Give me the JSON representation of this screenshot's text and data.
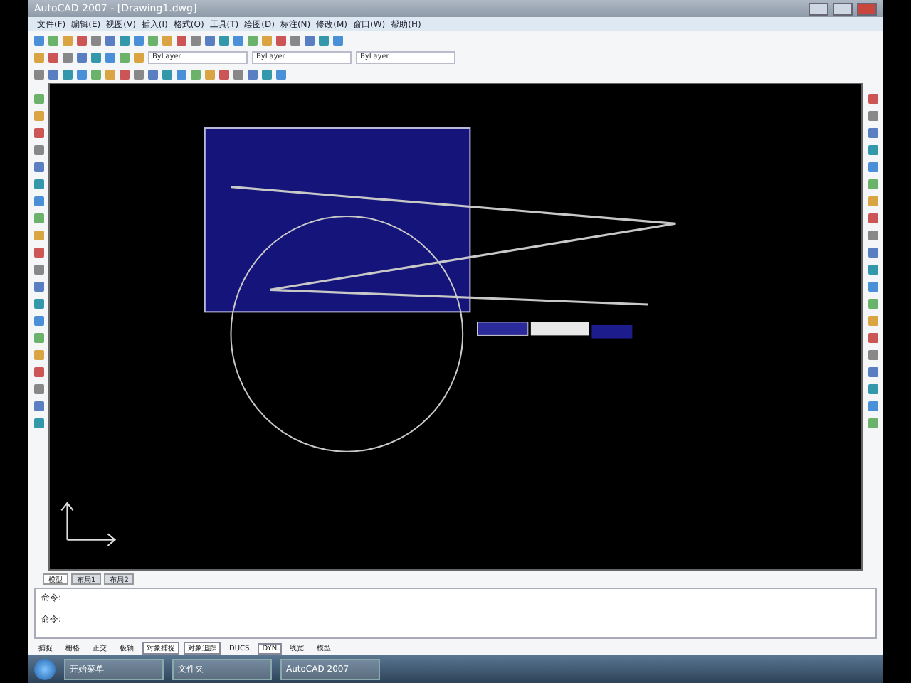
{
  "window": {
    "title": "AutoCAD 2007 - [Drawing1.dwg]"
  },
  "menu": [
    "文件(F)",
    "编辑(E)",
    "视图(V)",
    "插入(I)",
    "格式(O)",
    "工具(T)",
    "绘图(D)",
    "标注(N)",
    "修改(M)",
    "窗口(W)",
    "帮助(H)"
  ],
  "properties": {
    "color_control": "ByLayer",
    "linetype_control": "ByLayer",
    "lineweight_control": "ByLayer"
  },
  "layout_tabs": [
    {
      "label": "模型",
      "selected": true
    },
    {
      "label": "布局1",
      "selected": false
    },
    {
      "label": "布局2",
      "selected": false
    }
  ],
  "command_lines": [
    "命令:",
    "命令:"
  ],
  "status_buttons": [
    {
      "label": "捕捉",
      "on": false
    },
    {
      "label": "栅格",
      "on": false
    },
    {
      "label": "正交",
      "on": false
    },
    {
      "label": "极轴",
      "on": false
    },
    {
      "label": "对象捕捉",
      "on": true
    },
    {
      "label": "对象追踪",
      "on": true
    },
    {
      "label": "DUCS",
      "on": false
    },
    {
      "label": "DYN",
      "on": true
    },
    {
      "label": "线宽",
      "on": false
    },
    {
      "label": "模型",
      "on": false
    }
  ],
  "taskbar": [
    {
      "label": "开始菜单"
    },
    {
      "label": "文件夹"
    },
    {
      "label": "AutoCAD 2007"
    }
  ]
}
